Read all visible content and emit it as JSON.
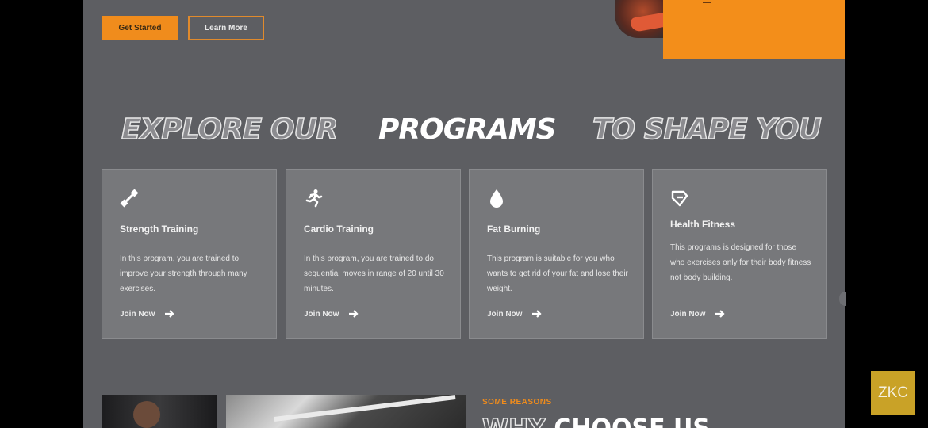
{
  "hero": {
    "get_started_label": "Get Started",
    "learn_more_label": "Learn More"
  },
  "programs": {
    "heading_left": "EXPLORE OUR",
    "heading_center": "PROGRAMS",
    "heading_right": "TO SHAPE YOU",
    "cards": [
      {
        "icon": "strength-icon",
        "title": "Strength Training",
        "description": "In this program, you are trained to improve your strength through many exercises.",
        "cta": "Join Now"
      },
      {
        "icon": "cardio-runner-icon",
        "title": "Cardio Training",
        "description": "In this program, you are trained to do sequential moves in range of 20 until 30 minutes.",
        "cta": "Join Now"
      },
      {
        "icon": "fat-burning-drop-icon",
        "title": "Fat Burning",
        "description": "This program is suitable for you who wants to get rid of your fat and lose their weight.",
        "cta": "Join Now"
      },
      {
        "icon": "health-fitness-icon",
        "title": "Health Fitness",
        "description": "This programs is designed for those who exercises only for their body fitness not body building.",
        "cta": "Join Now"
      }
    ]
  },
  "why": {
    "eyebrow": "SOME REASONS",
    "heading_outline": "WHY",
    "heading_solid": "CHOOSE US"
  },
  "watermark": {
    "text": "ZKC"
  },
  "colors": {
    "accent": "#f08c1c",
    "page_bg": "#5d5e62",
    "card_bg": "#77787b"
  }
}
